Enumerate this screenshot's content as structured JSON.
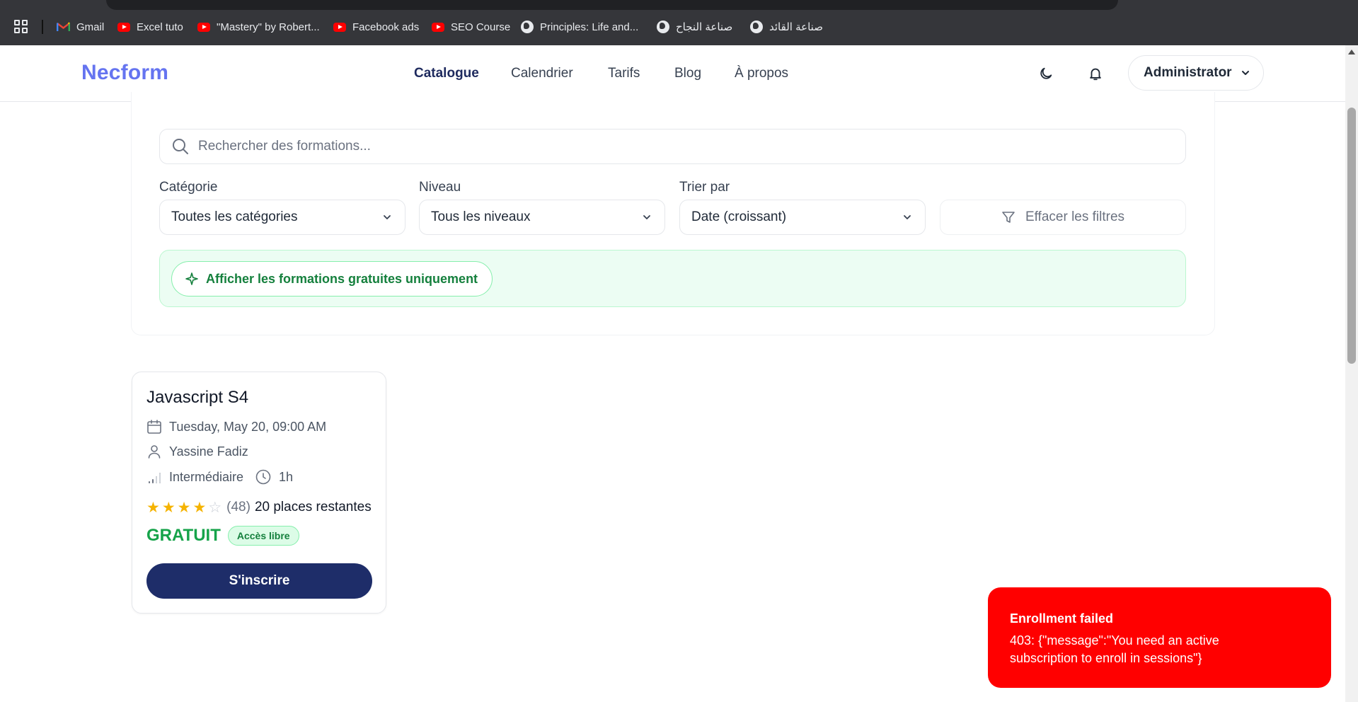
{
  "browser": {
    "bookmarks": [
      {
        "label": "Gmail",
        "icon": "gmail-icon"
      },
      {
        "label": "Excel tuto",
        "icon": "youtube-icon"
      },
      {
        "label": "\"Mastery\" by Robert...",
        "icon": "youtube-icon"
      },
      {
        "label": "Facebook ads",
        "icon": "youtube-icon"
      },
      {
        "label": "SEO Course",
        "icon": "youtube-icon"
      },
      {
        "label": "Principles: Life and...",
        "icon": "globe-icon"
      },
      {
        "label": "صناعة النجاح",
        "icon": "globe-icon"
      },
      {
        "label": "صناعة القائد",
        "icon": "globe-icon"
      }
    ]
  },
  "header": {
    "logo": "Necform",
    "nav": [
      {
        "label": "Catalogue",
        "active": true
      },
      {
        "label": "Calendrier",
        "active": false
      },
      {
        "label": "Tarifs",
        "active": false
      },
      {
        "label": "Blog",
        "active": false
      },
      {
        "label": "À propos",
        "active": false
      }
    ],
    "user_menu": "Administrator",
    "accent_color": "#6574f0"
  },
  "filters": {
    "search_placeholder": "Rechercher des formations...",
    "category": {
      "label": "Catégorie",
      "value": "Toutes les catégories"
    },
    "level": {
      "label": "Niveau",
      "value": "Tous les niveaux"
    },
    "sort": {
      "label": "Trier par",
      "value": "Date (croissant)"
    },
    "clear_label": "Effacer les filtres",
    "free_only_label": "Afficher les formations gratuites uniquement"
  },
  "course": {
    "title": "Javascript S4",
    "date": "Tuesday, May 20, 09:00 AM",
    "instructor": "Yassine Fadiz",
    "level": "Intermédiaire",
    "duration": "1h",
    "rating": 4,
    "rating_max": 5,
    "review_count": "(48)",
    "places": "20 places restantes",
    "price": "GRATUIT",
    "access_badge": "Accès libre",
    "enroll_label": "S'inscrire",
    "button_color": "#1e2d69"
  },
  "toast": {
    "title": "Enrollment failed",
    "message": "403: {\"message\":\"You need an active subscription to enroll in sessions\"}",
    "color": "#ff0000"
  }
}
